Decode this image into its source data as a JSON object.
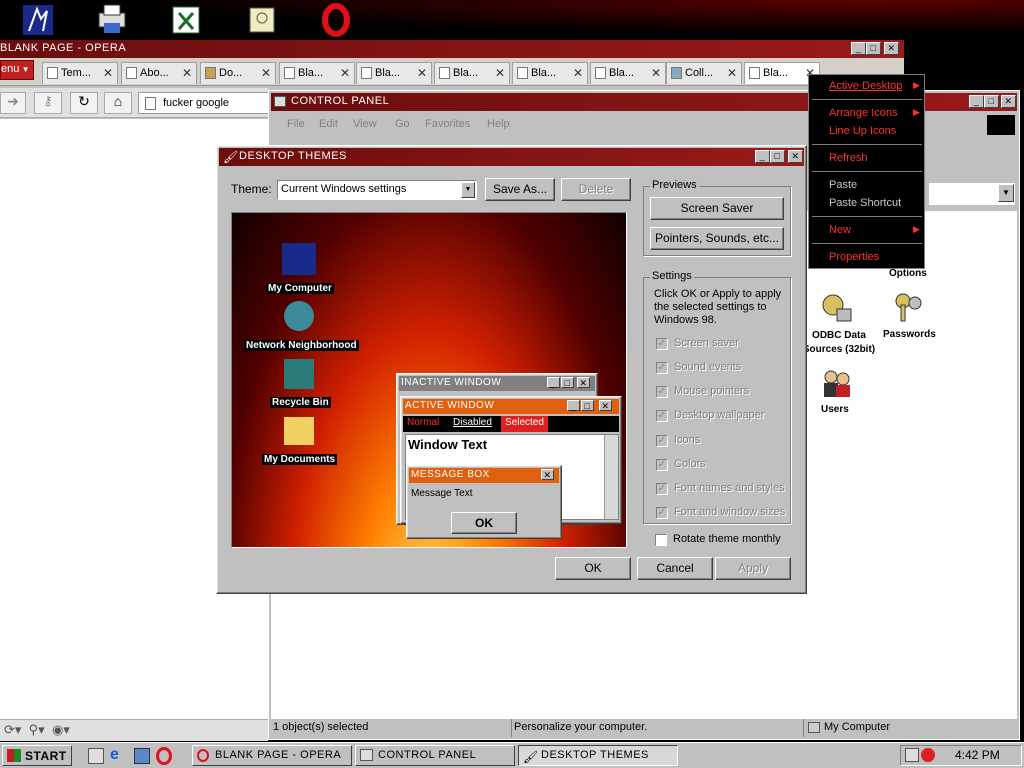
{
  "opera": {
    "title": "BLANK PAGE - OPERA",
    "menu_label": "enu",
    "tabs": [
      {
        "label": "Tem..."
      },
      {
        "label": "Abo..."
      },
      {
        "label": "Do..."
      },
      {
        "label": "Bla..."
      },
      {
        "label": "Bla..."
      },
      {
        "label": "Bla..."
      },
      {
        "label": "Bla..."
      },
      {
        "label": "Bla..."
      },
      {
        "label": "Coll..."
      },
      {
        "label": "Bla..."
      }
    ],
    "address": "fucker google"
  },
  "control_panel": {
    "title": "CONTROL PANEL",
    "menu": [
      "File",
      "Edit",
      "View",
      "Go",
      "Favorites",
      "Help"
    ],
    "items": [
      {
        "label": "Options"
      },
      {
        "label": "ODBC Data Sources (32bit)"
      },
      {
        "label": "Passwords"
      },
      {
        "label": "Users"
      }
    ],
    "status": {
      "left": "1 object(s) selected",
      "middle": "Personalize your computer.",
      "right": "My Computer"
    }
  },
  "context_menu": {
    "items": [
      "Active Desktop",
      "Arrange Icons",
      "Line Up Icons",
      "Refresh",
      "Paste",
      "Paste Shortcut",
      "New",
      "Properties"
    ]
  },
  "themes": {
    "title": "DESKTOP THEMES",
    "theme_label": "Theme:",
    "theme_value": "Current Windows settings",
    "save_as": "Save As...",
    "delete": "Delete",
    "previews_label": "Previews",
    "screen_saver": "Screen Saver",
    "pointers": "Pointers, Sounds, etc...",
    "settings_label": "Settings",
    "settings_desc": "Click OK or Apply to apply the selected settings to Windows 98.",
    "settings": [
      "Screen saver",
      "Sound events",
      "Mouse pointers",
      "Desktop wallpaper",
      "Icons",
      "Colors",
      "Font names and styles",
      "Font and window sizes"
    ],
    "rotate": "Rotate theme monthly",
    "ok": "OK",
    "cancel": "Cancel",
    "apply": "Apply",
    "preview": {
      "icons": [
        "My Computer",
        "Network Neighborhood",
        "Recycle Bin",
        "My Documents"
      ],
      "inactive_title": "INACTIVE WINDOW",
      "active_title": "ACTIVE WINDOW",
      "normal": "Normal",
      "disabled": "Disabled",
      "selected": "Selected",
      "window_text": "Window Text",
      "msgbox_title": "MESSAGE BOX",
      "msgbox_text": "Message Text",
      "msgbox_ok": "OK"
    }
  },
  "taskbar": {
    "start": "START",
    "tasks": [
      "BLANK PAGE - OPERA",
      "CONTROL PANEL",
      "DESKTOP THEMES"
    ],
    "clock": "4:42 PM"
  },
  "colors": {
    "accent": "#8b1010",
    "menu_text": "#ff3030"
  }
}
